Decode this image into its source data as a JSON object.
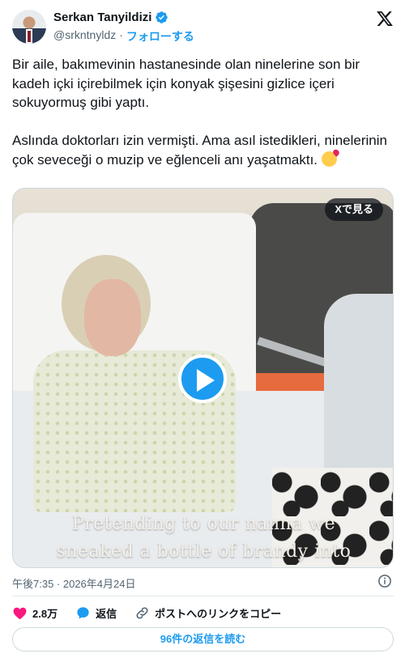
{
  "author": {
    "name": "Serkan Tanyildizi",
    "handle": "@srkntnyldz",
    "separator": "·",
    "follow_label": "フォローする",
    "verified": true
  },
  "tweet": {
    "paragraph1": "Bir aile, bakımevinin hastanesinde olan ninelerine son bir kadeh içki içirebilmek için konyak şişesini gizlice içeri sokuyormuş gibi yaptı.",
    "paragraph2": "Aslında doktorları izin vermişti. Ama asıl istedikleri, ninelerinin çok seveceği o muzip ve eğlenceli anı yaşatmaktı."
  },
  "media": {
    "view_on_x_label": "Xで見る",
    "caption_line1": "Pretending to our nanna we",
    "caption_line2": "sneaked a bottle of brandy into"
  },
  "meta": {
    "timestamp": "午後7:35 · 2026年4月24日"
  },
  "actions": {
    "likes": "2.8万",
    "reply_label": "返信",
    "copy_link_label": "ポストへのリンクをコピー"
  },
  "read_replies_label": "96件の返信を読む",
  "colors": {
    "accent": "#1d9bf0",
    "like": "#f91880",
    "text": "#0f1419",
    "muted": "#536471"
  },
  "icons": [
    "verified-badge-icon",
    "x-logo-icon",
    "play-icon",
    "info-icon",
    "heart-icon",
    "reply-bubble-icon",
    "link-icon",
    "smiling-face-with-hearts-emoji"
  ]
}
